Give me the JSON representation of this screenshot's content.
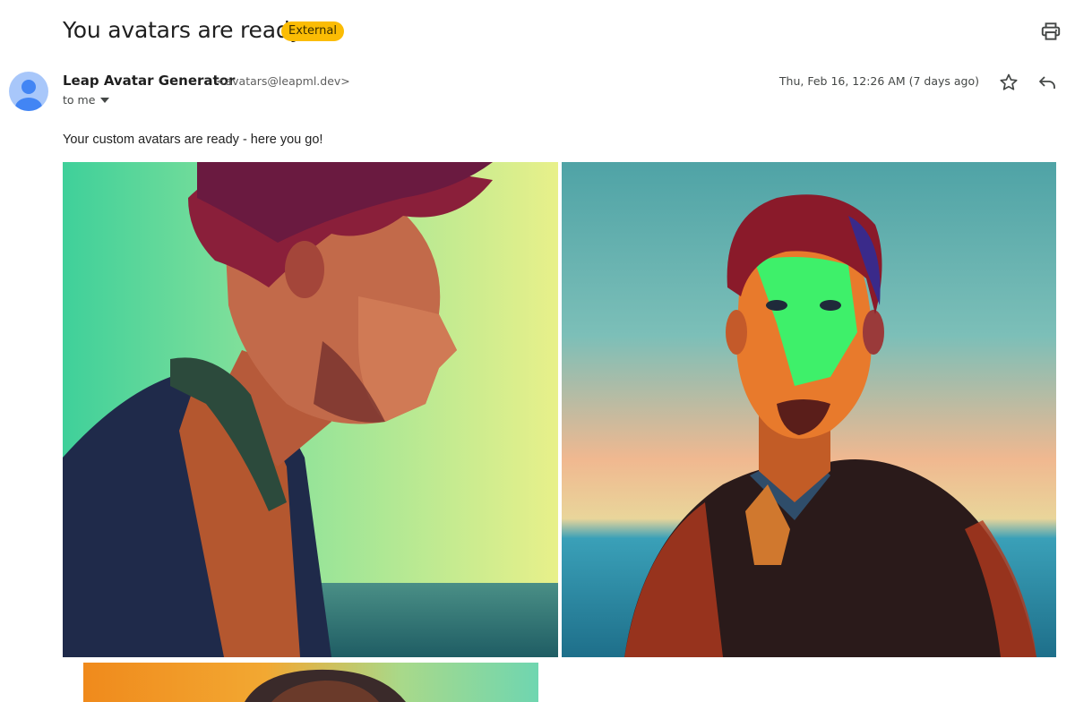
{
  "email": {
    "subject": "You avatars are ready!",
    "badge": "External",
    "sender_name": "Leap Avatar Generator",
    "sender_email": "<avatars@leapml.dev>",
    "recipient": "to me",
    "date": "Thu, Feb 16, 12:26 AM (7 days ago)",
    "body": "Your custom avatars are ready - here you go!"
  },
  "icons": {
    "print": "print-icon",
    "star": "star-icon",
    "reply": "reply-icon",
    "avatar": "person-avatar-icon",
    "dropdown": "chevron-down-icon"
  },
  "colors": {
    "badge_bg": "#fbbc04",
    "avatar_bg": "#a8c7fa",
    "avatar_fg": "#4285f4"
  }
}
